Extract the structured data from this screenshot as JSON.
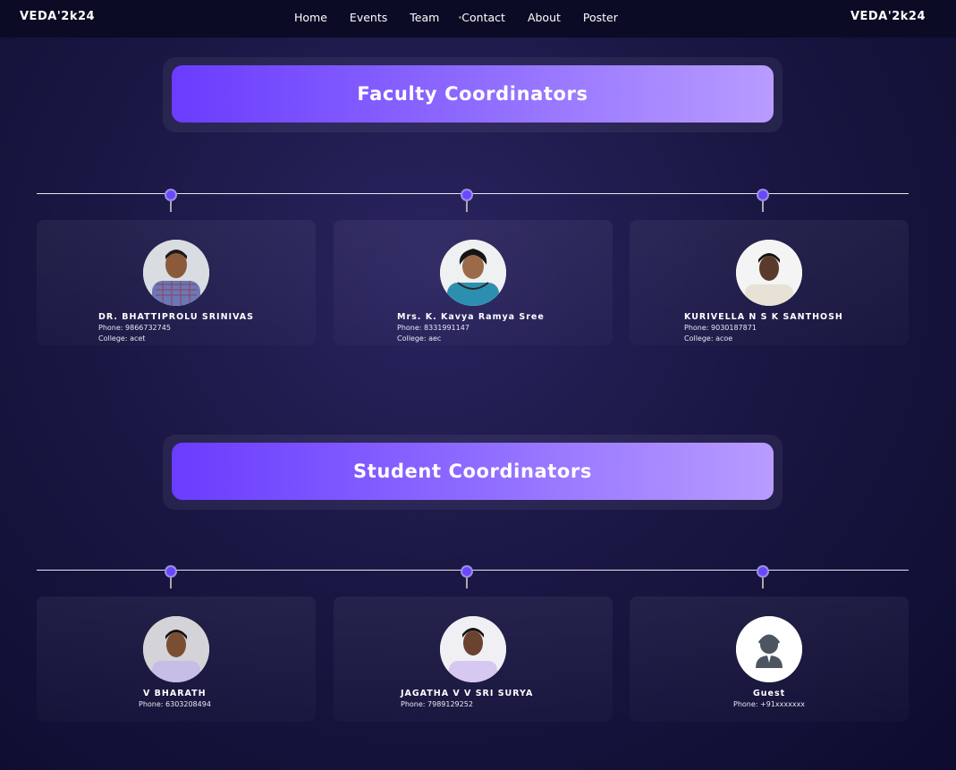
{
  "nav": {
    "brand_left": "VEDA'2k24",
    "brand_right": "VEDA'2k24",
    "links": [
      "Home",
      "Events",
      "Team",
      "Contact",
      "About",
      "Poster"
    ]
  },
  "faculty": {
    "title": "Faculty Coordinators",
    "people": [
      {
        "name": "DR. BHATTIPROLU SRINIVAS",
        "phone": "Phone:  9866732745",
        "college": "College:  acet"
      },
      {
        "name": "Mrs. K. Kavya Ramya Sree",
        "phone": "Phone:  8331991147",
        "college": "College:  aec"
      },
      {
        "name": "KURIVELLA N S K SANTHOSH",
        "phone": "Phone:  9030187871",
        "college": "College:  acoe"
      }
    ]
  },
  "students": {
    "title": "Student Coordinators",
    "people": [
      {
        "name": "V BHARATH",
        "phone": "Phone:  6303208494"
      },
      {
        "name": "JAGATHA V V SRI SURYA",
        "phone": "Phone:  7989129252"
      },
      {
        "name": "Guest",
        "phone": "Phone:  +91xxxxxxx"
      }
    ]
  },
  "colors": {
    "accent_start": "#6a3cff",
    "accent_end": "#b89cff",
    "node": "#6a48ff"
  }
}
